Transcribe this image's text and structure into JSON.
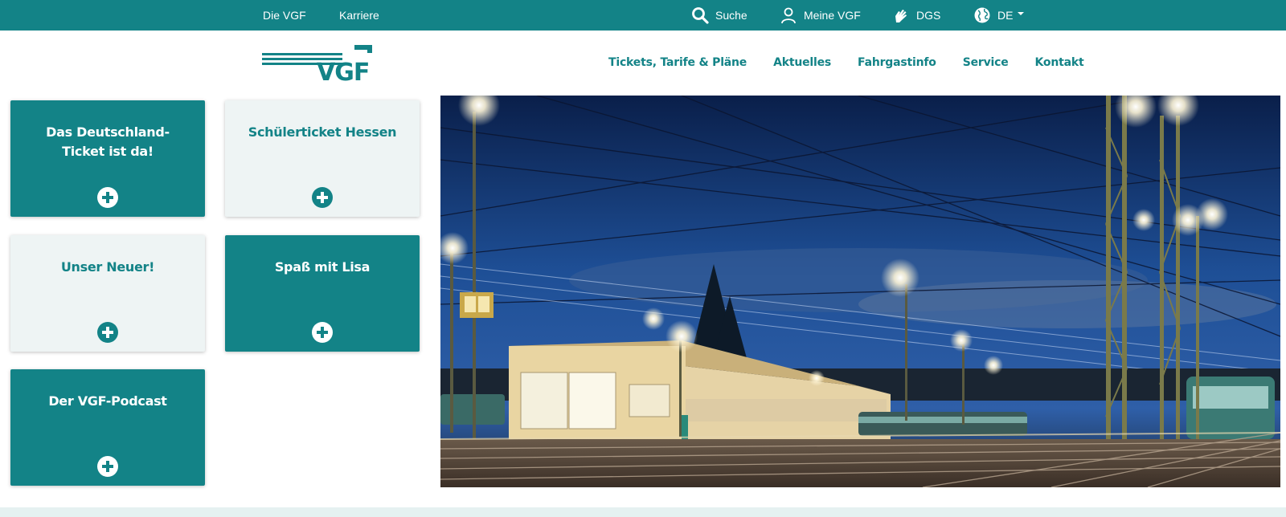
{
  "topbar": {
    "links": [
      "Die VGF",
      "Karriere"
    ],
    "search_label": "Suche",
    "account_label": "Meine VGF",
    "dgs_label": "DGS",
    "language_label": "DE"
  },
  "logo": {
    "text": "VGF"
  },
  "nav": {
    "items": [
      "Tickets, Tarife & Pläne",
      "Aktuelles",
      "Fahrgastinfo",
      "Service",
      "Kontakt"
    ]
  },
  "tiles": [
    {
      "title": "Das Deutschland-Ticket ist da!",
      "style": "dark"
    },
    {
      "title": "Schülerticket Hessen",
      "style": "light"
    },
    {
      "title": "Unser Neuer!",
      "style": "light"
    },
    {
      "title": "Spaß mit Lisa",
      "style": "dark"
    },
    {
      "title": "Der VGF-Podcast",
      "style": "dark"
    }
  ],
  "colors": {
    "brand": "#138387",
    "tile_light": "#eef4f4",
    "band": "#e5f1f1"
  },
  "icons": {
    "search": "search-icon",
    "account": "user-icon",
    "dgs": "sign-language-icon",
    "language": "globe-icon",
    "dropdown": "caret-down-icon",
    "tile": "plus-circle-icon"
  }
}
